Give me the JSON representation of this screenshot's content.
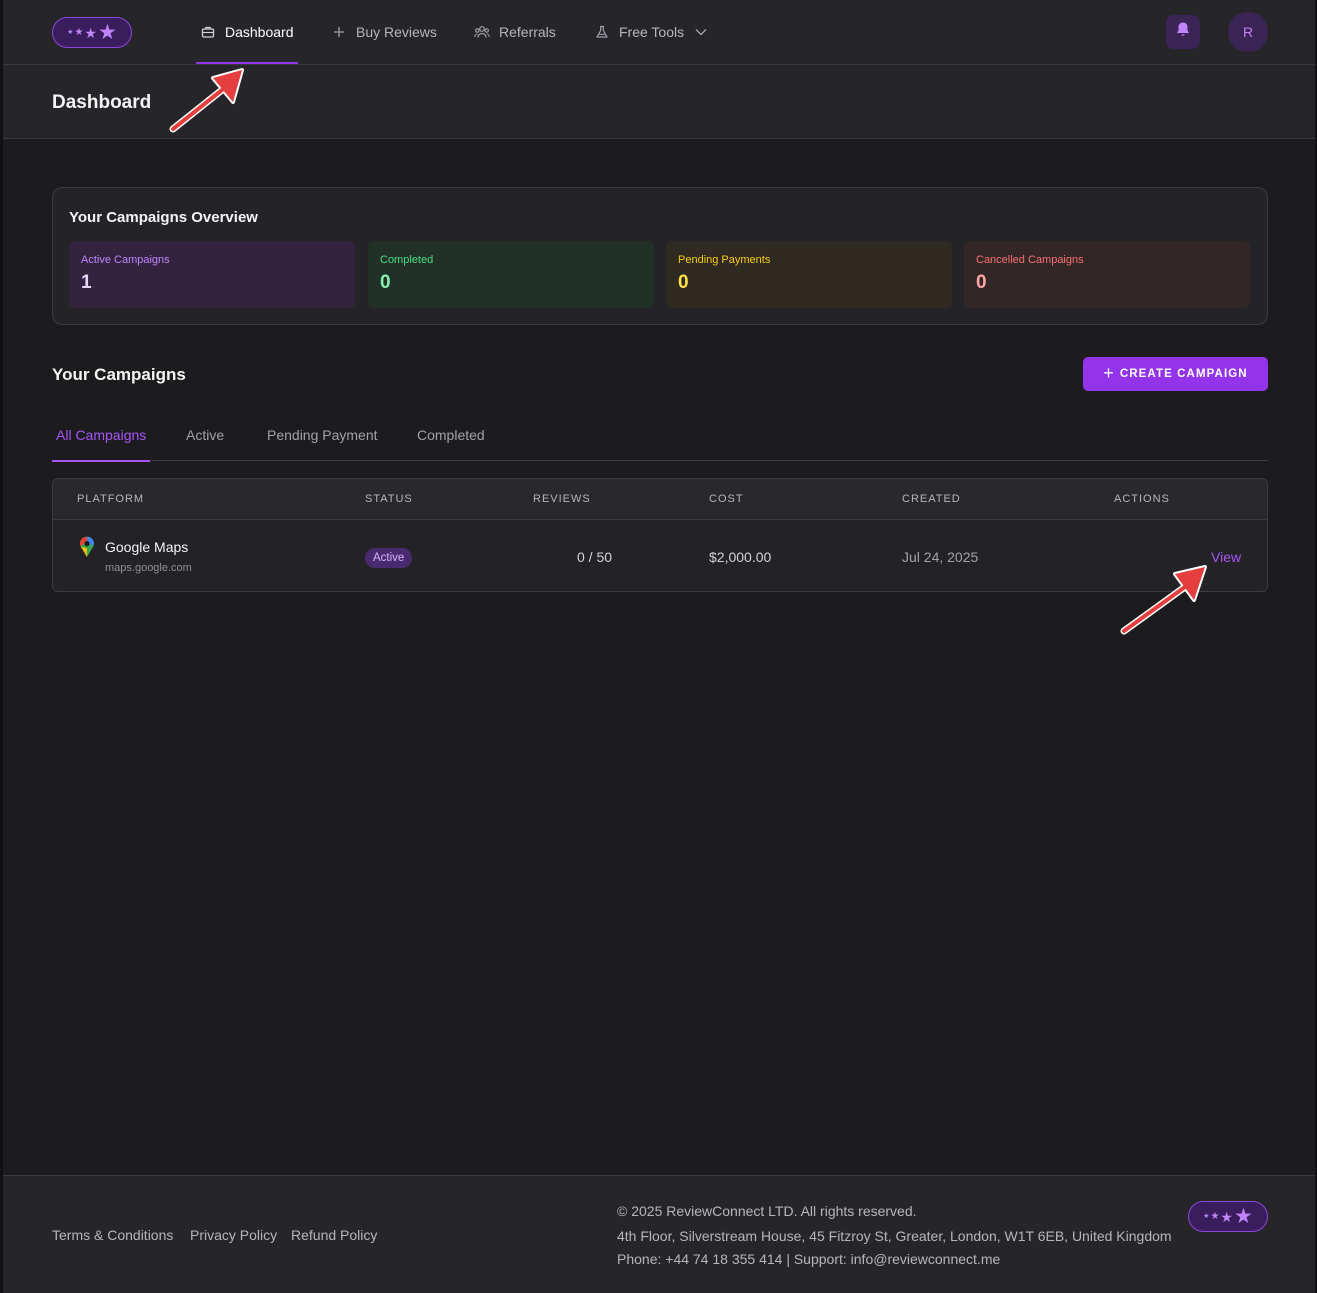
{
  "nav": {
    "items": [
      {
        "label": "Dashboard",
        "icon": "briefcase-icon",
        "active": true
      },
      {
        "label": "Buy Reviews",
        "icon": "plus-icon",
        "active": false
      },
      {
        "label": "Referrals",
        "icon": "users-icon",
        "active": false
      },
      {
        "label": "Free Tools",
        "icon": "flask-icon",
        "active": false
      }
    ],
    "avatar_initial": "R"
  },
  "page": {
    "title": "Dashboard"
  },
  "overview": {
    "title": "Your Campaigns Overview",
    "stats": [
      {
        "label": "Active Campaigns",
        "value": "1",
        "color": "#c084fc"
      },
      {
        "label": "Completed",
        "value": "0",
        "color": "#4ade80"
      },
      {
        "label": "Pending Payments",
        "value": "0",
        "color": "#facc15"
      },
      {
        "label": "Cancelled Campaigns",
        "value": "0",
        "color": "#f87171"
      }
    ]
  },
  "campaigns": {
    "title": "Your Campaigns",
    "create_label": "CREATE CAMPAIGN",
    "tabs": [
      {
        "label": "All Campaigns",
        "active": true
      },
      {
        "label": "Active",
        "active": false
      },
      {
        "label": "Pending Payment",
        "active": false
      },
      {
        "label": "Completed",
        "active": false
      }
    ],
    "columns": [
      "PLATFORM",
      "STATUS",
      "REVIEWS",
      "COST",
      "CREATED",
      "ACTIONS"
    ],
    "rows": [
      {
        "platform": "Google Maps",
        "url": "maps.google.com",
        "icon": "google-maps-pin-icon",
        "status": "Active",
        "reviews": "0 / 50",
        "cost": "$2,000.00",
        "created": "Jul 24, 2025",
        "action": "View"
      }
    ]
  },
  "footer": {
    "links": [
      "Terms & Conditions",
      "Privacy Policy",
      "Refund Policy"
    ],
    "copyright": "© 2025 ReviewConnect LTD. All rights reserved.",
    "address": "4th Floor, Silverstream House, 45 Fitzroy St, Greater, London, W1T 6EB, United Kingdom",
    "contact": "Phone: +44 74 18 355 414 | Support:  info@reviewconnect.me"
  },
  "theme": {
    "accent": "#9333ea",
    "background": "#1c1c1f",
    "annotation_arrow": "#ef4444"
  }
}
